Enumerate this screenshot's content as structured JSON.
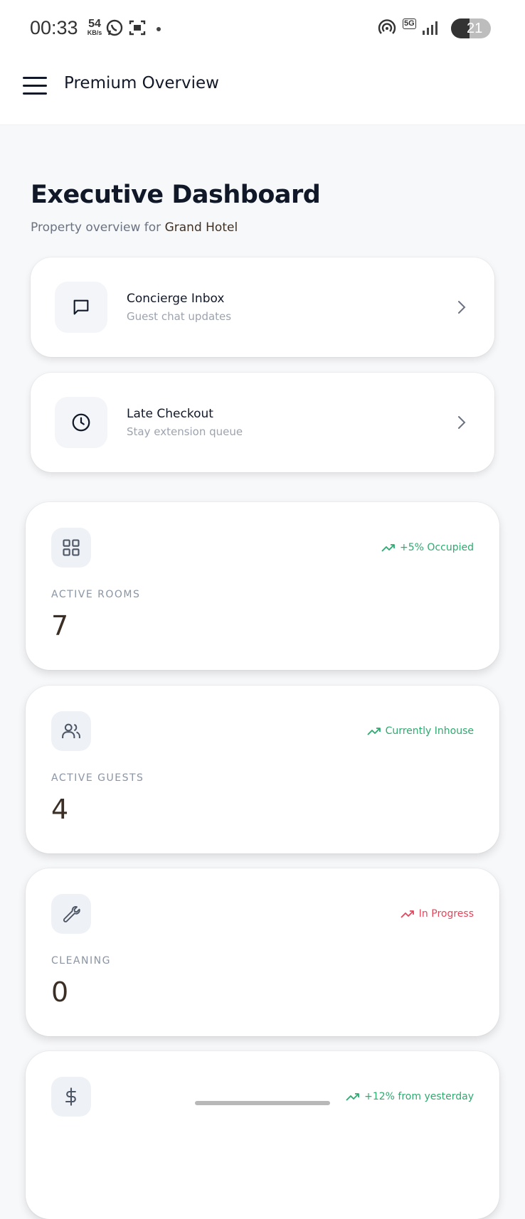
{
  "status_bar": {
    "time": "00:33",
    "speed_value": "54",
    "speed_unit": "KB/s",
    "network": "5G",
    "battery": "21"
  },
  "app_bar": {
    "title": "Premium Overview"
  },
  "page": {
    "title": "Executive Dashboard",
    "subtitle_prefix": "Property overview for",
    "hotel_name": "Grand Hotel"
  },
  "nav_cards": [
    {
      "title": "Concierge Inbox",
      "subtitle": "Guest chat updates",
      "icon": "chat-bubble-icon"
    },
    {
      "title": "Late Checkout",
      "subtitle": "Stay extension queue",
      "icon": "clock-icon"
    }
  ],
  "stats": [
    {
      "label": "ACTIVE ROOMS",
      "value": "7",
      "trend": "+5% Occupied",
      "trend_color": "#2eaa6f",
      "icon": "grid-icon"
    },
    {
      "label": "ACTIVE GUESTS",
      "value": "4",
      "trend": "Currently Inhouse",
      "trend_color": "#2eaa6f",
      "icon": "users-icon"
    },
    {
      "label": "CLEANING",
      "value": "0",
      "trend": "In Progress",
      "trend_color": "#e0475d",
      "icon": "wrench-icon"
    },
    {
      "label": "",
      "value": "",
      "trend": "+12% from yesterday",
      "trend_color": "#2eaa6f",
      "icon": "dollar-icon"
    }
  ]
}
